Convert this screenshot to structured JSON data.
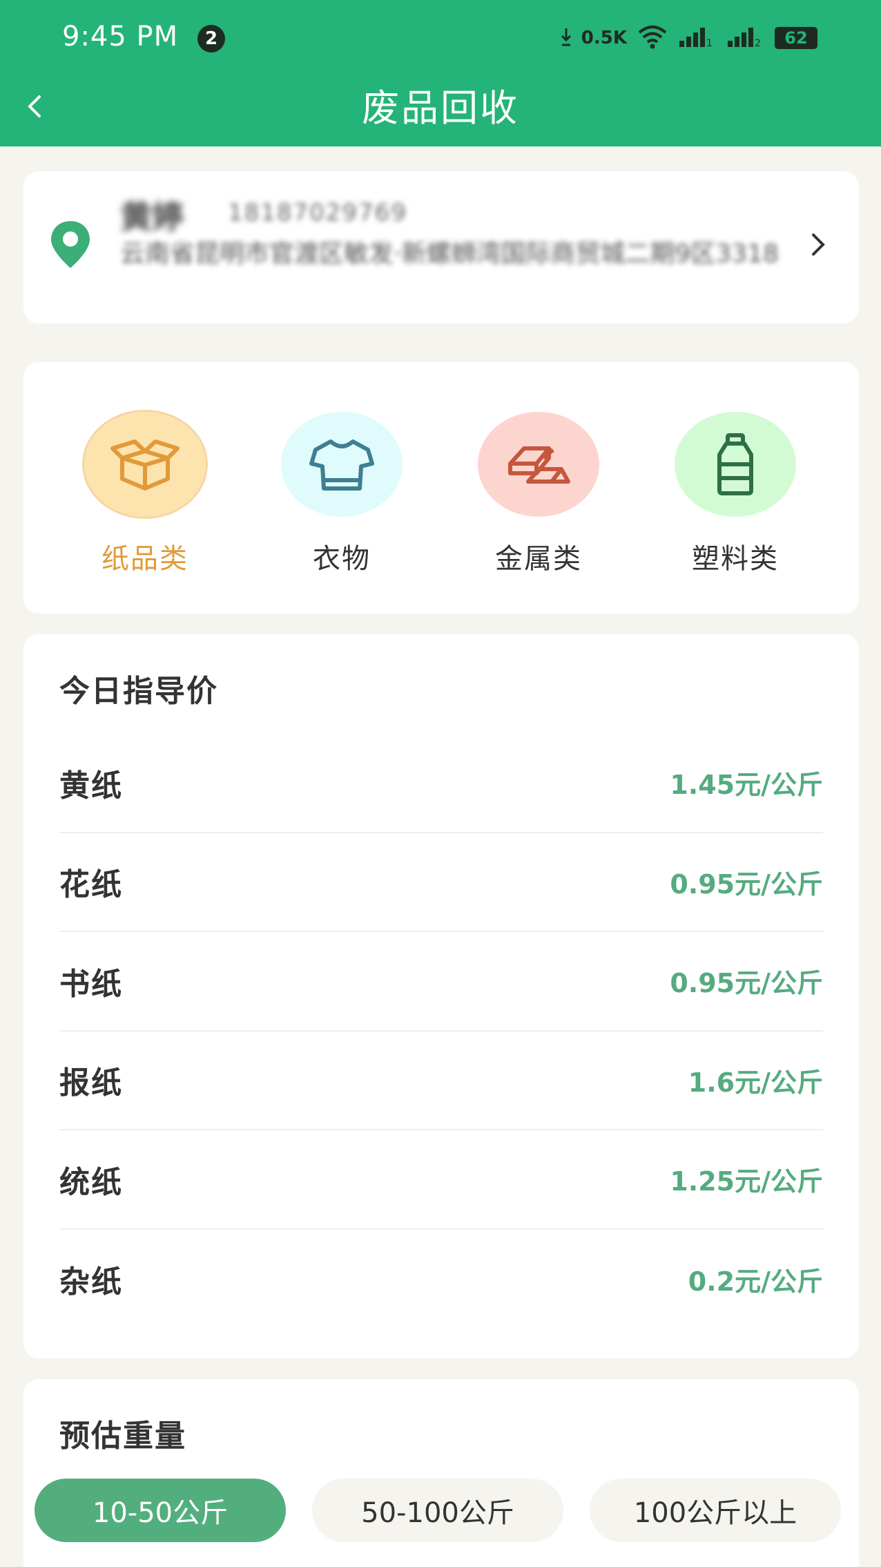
{
  "status_bar": {
    "time": "9:45 PM",
    "badge": "2",
    "net_speed": "0.5K",
    "battery": "62"
  },
  "header": {
    "title": "废品回收"
  },
  "address": {
    "name": "黄婷",
    "phone": "18187029769",
    "line": "云南省昆明市官渡区敏发·新螺蛳湾国际商贸城二期9区3318"
  },
  "categories": [
    {
      "label": "纸品类",
      "icon": "box-icon",
      "bg": "#fde3ad",
      "selected": true
    },
    {
      "label": "衣物",
      "icon": "shirt-icon",
      "bg": "#e0fbfb",
      "selected": false
    },
    {
      "label": "金属类",
      "icon": "metal-bars-icon",
      "bg": "#fdd5cf",
      "selected": false
    },
    {
      "label": "塑料类",
      "icon": "bottle-icon",
      "bg": "#d2fbd4",
      "selected": false
    }
  ],
  "price_section": {
    "title": "今日指导价",
    "items": [
      {
        "name": "黄纸",
        "price": "1.45元/公斤"
      },
      {
        "name": "花纸",
        "price": "0.95元/公斤"
      },
      {
        "name": "书纸",
        "price": "0.95元/公斤"
      },
      {
        "name": "报纸",
        "price": "1.6元/公斤"
      },
      {
        "name": "统纸",
        "price": "1.25元/公斤"
      },
      {
        "name": "杂纸",
        "price": "0.2元/公斤"
      }
    ]
  },
  "weight_section": {
    "title": "预估重量",
    "options": [
      {
        "label": "10-50公斤",
        "selected": true
      },
      {
        "label": "50-100公斤",
        "selected": false
      },
      {
        "label": "100公斤以上",
        "selected": false
      }
    ]
  },
  "colors": {
    "brand": "#24b378",
    "price": "#55ab80",
    "active_category": "#e19a3a"
  }
}
